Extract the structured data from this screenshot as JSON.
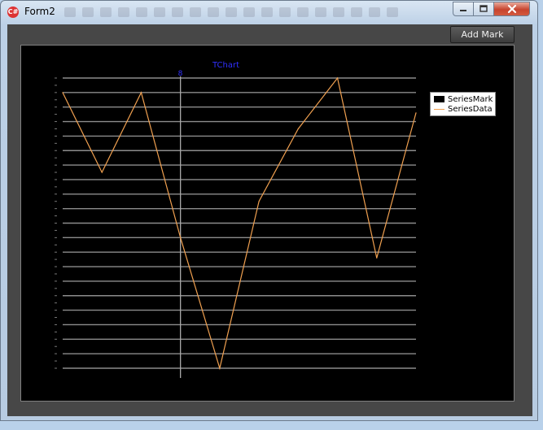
{
  "window": {
    "title": "Form2",
    "app_icon": "C#",
    "buttons": {
      "minimize_icon": "minimize-icon",
      "maximize_icon": "maximize-icon",
      "close_icon": "close-icon"
    }
  },
  "toolbar": {
    "add_mark_label": "Add Mark"
  },
  "chart": {
    "title": "TChart",
    "mark_label": "8",
    "legend": [
      {
        "name": "SeriesMark",
        "style": "box",
        "color": "#000000"
      },
      {
        "name": "SeriesData",
        "style": "line",
        "color": "#f0a050"
      }
    ]
  },
  "chart_data": {
    "type": "line",
    "title": "TChart",
    "xlim": [
      0,
      9
    ],
    "ylim": [
      0,
      20
    ],
    "series": [
      {
        "name": "SeriesData",
        "color": "#f0a050",
        "x": [
          0,
          1,
          2,
          3,
          4,
          5,
          6,
          7,
          8,
          9
        ],
        "y": [
          19,
          13.5,
          19,
          9,
          0,
          11.5,
          16.5,
          20,
          7.6,
          17.6
        ]
      },
      {
        "name": "SeriesMark",
        "color": "#aaaaaa",
        "mark_x": 3
      }
    ],
    "gridlines": true,
    "gridline_count": 21,
    "legend_position": "top-right"
  },
  "colors": {
    "chart_bg": "#000000",
    "grid": "#8c8c8c",
    "series_line": "#f0a050",
    "title": "#3030ff",
    "client_bg": "#474747"
  }
}
